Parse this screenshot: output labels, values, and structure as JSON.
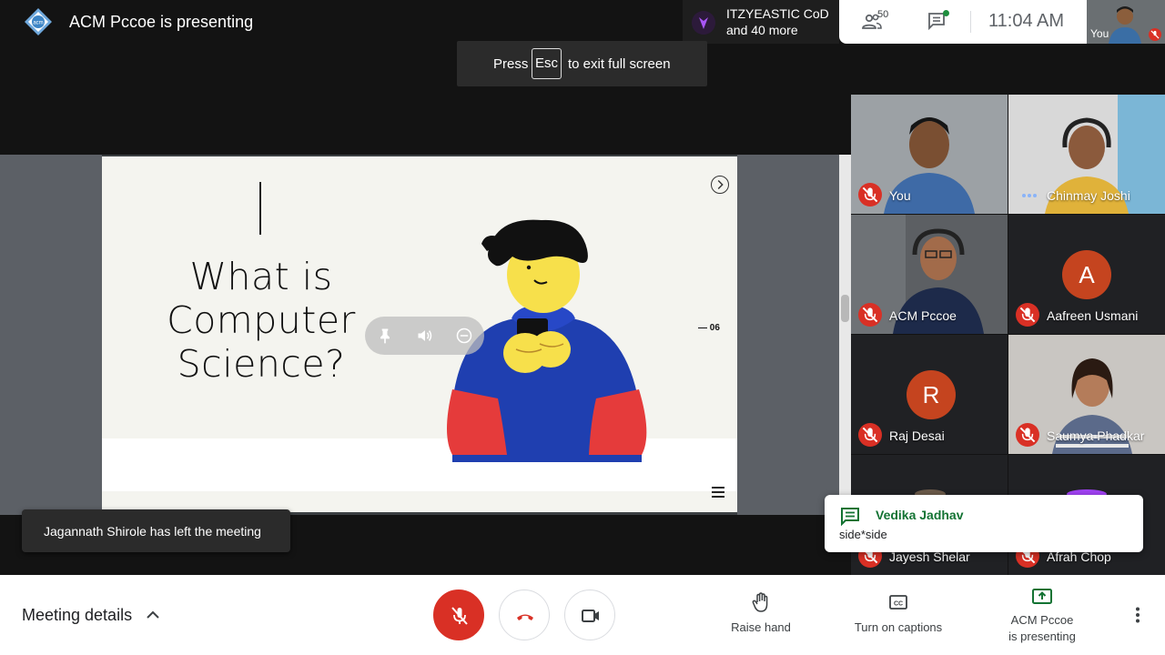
{
  "header": {
    "title": "ACM Pccoe is presenting",
    "participants_summary_line1": "ITZYEASTIC CoD",
    "participants_summary_line2": "and 40 more",
    "people_count": "50",
    "clock": "11:04  AM",
    "self_label": "You"
  },
  "fullscreen_hint": {
    "press": "Press",
    "key": "Esc",
    "rest": "to exit full screen"
  },
  "slide": {
    "title_line1": "What is",
    "title_line2": "Computer",
    "title_line3": "Science?",
    "page_number": "— 06"
  },
  "notification": "Jagannath Shirole has left the meeting",
  "tiles": [
    {
      "name": "You",
      "muted": true
    },
    {
      "name": "Chinmay Joshi",
      "speaking": true
    },
    {
      "name": "ACM Pccoe",
      "muted": true
    },
    {
      "name": "Aafreen Usmani",
      "muted": true,
      "letter": "A",
      "color": "#c5441f"
    },
    {
      "name": "Raj Desai",
      "muted": true,
      "letter": "R",
      "color": "#c5441f"
    },
    {
      "name": "Saumya Phadkar",
      "muted": true
    },
    {
      "name": "Jayesh Shelar",
      "muted": true
    },
    {
      "name": "Afrah Chop",
      "muted": true
    }
  ],
  "chat_toast": {
    "sender": "Vedika Jadhav",
    "message": "side*side"
  },
  "bottom_bar": {
    "meeting_details": "Meeting details",
    "raise_hand": "Raise hand",
    "captions": "Turn on captions",
    "presenting_line1": "ACM Pccoe",
    "presenting_line2": "is presenting"
  },
  "colors": {
    "danger": "#d93025",
    "chat_accent": "#137333",
    "avatar_orange": "#c5441f"
  }
}
